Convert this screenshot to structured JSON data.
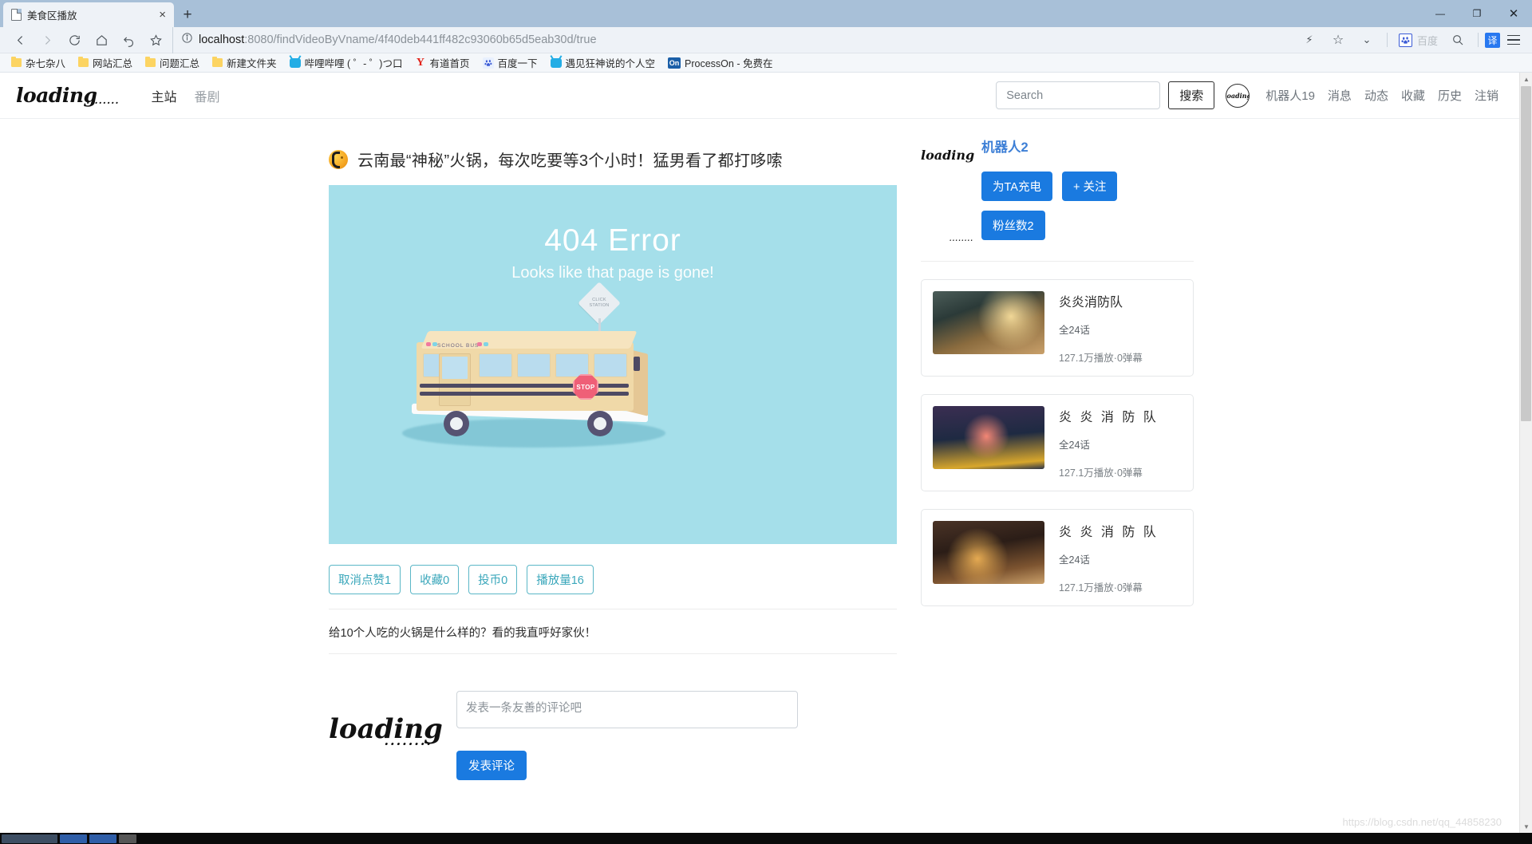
{
  "browser": {
    "tab": {
      "title": "美食区播放",
      "close_label": "×",
      "favicon": "page-icon"
    },
    "new_tab_label": "+",
    "window_controls": {
      "minimize": "—",
      "maximize": "❐",
      "close": "✕"
    },
    "nav": {
      "back": "back-icon",
      "forward": "forward-icon",
      "reload": "reload-icon",
      "home": "home-icon",
      "undo": "undo-icon",
      "star": "star-icon",
      "info": "info-icon",
      "url_host": "localhost",
      "url_path": ":8080/findVideoByVname/4f40deb441ff482c93060b65d5eab30d/true",
      "lightning": "⚡",
      "bookmark_star": "☆",
      "chevron": "⌄",
      "engine_label": "百度",
      "search_icon": "search-icon",
      "translate_label": "译",
      "menu_icon": "hamburger-icon"
    },
    "bookmarks": [
      {
        "label": "杂七杂八",
        "icon": "folder-icon"
      },
      {
        "label": "网站汇总",
        "icon": "folder-icon"
      },
      {
        "label": "问题汇总",
        "icon": "folder-icon"
      },
      {
        "label": "新建文件夹",
        "icon": "folder-icon"
      },
      {
        "label": "哔哩哔哩 ( ゜- ゜)つ口",
        "icon": "bilibili-icon"
      },
      {
        "label": "有道首页",
        "icon": "youdao-icon"
      },
      {
        "label": "百度一下",
        "icon": "baidu-icon"
      },
      {
        "label": "遇见狂神说的个人空",
        "icon": "bilibili-icon"
      },
      {
        "label": "ProcessOn - 免费在",
        "icon": "processon-icon"
      }
    ]
  },
  "site": {
    "logo": "loading",
    "logo_dots": "........",
    "nav": [
      {
        "label": "主站",
        "state": "active"
      },
      {
        "label": "番剧",
        "state": "muted"
      }
    ],
    "search": {
      "placeholder": "Search",
      "value": "",
      "button_label": "搜索"
    },
    "avatar_label": "loading",
    "user_nav": [
      {
        "label": "机器人19"
      },
      {
        "label": "消息"
      },
      {
        "label": "动态"
      },
      {
        "label": "收藏"
      },
      {
        "label": "历史"
      },
      {
        "label": "注销"
      }
    ]
  },
  "video": {
    "title": "云南最“神秘”火锅，每次吃要等3个小时！猛男看了都打哆嗦",
    "title_emoji": "fire-pot-emoji",
    "player_placeholder": {
      "heading": "404 Error",
      "subheading": "Looks like that page is gone!",
      "sign_line1": "CLICK",
      "sign_line2": "STATION",
      "bus_label": "SCHOOL BUS",
      "stop_label": "STOP",
      "bg_color": "#a5dfea"
    },
    "actions": [
      {
        "label": "取消点赞1",
        "name": "like-button"
      },
      {
        "label": "收藏0",
        "name": "favorite-button"
      },
      {
        "label": "投币0",
        "name": "coin-button"
      },
      {
        "label": "播放量16",
        "name": "play-count-button"
      }
    ],
    "description": "给10个人吃的火锅是什么样的？看的我直呼好家伙！"
  },
  "comment": {
    "logo": "loading",
    "logo_dots": "........",
    "placeholder": "发表一条友善的评论吧",
    "value": "",
    "submit_label": "发表评论"
  },
  "author": {
    "logo": "loading",
    "logo_dots": "........",
    "name": "机器人2",
    "charge_label": "为TA充电",
    "follow_label": "+ 关注",
    "fans_label": "粉丝数2",
    "accent_color": "#1a7ae0"
  },
  "related": [
    {
      "title": "炎炎消防队",
      "episodes": "全24话",
      "stats": "127.1万播放·0弹幕",
      "spaced": false
    },
    {
      "title": "炎 炎 消 防 队",
      "episodes": "全24话",
      "stats": "127.1万播放·0弹幕",
      "spaced": true
    },
    {
      "title": "炎 炎 消 防 队",
      "episodes": "全24话",
      "stats": "127.1万播放·0弹幕",
      "spaced": true
    }
  ],
  "watermark": "https://blog.csdn.net/qq_44858230"
}
